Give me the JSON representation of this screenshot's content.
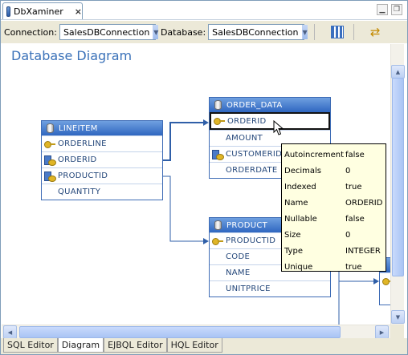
{
  "window": {
    "title": "DbXaminer",
    "close_glyph": "×",
    "minimize_glyph": "▁",
    "restore_glyph": "❐"
  },
  "toolbar": {
    "connection_label": "Connection:",
    "connection_value": "SalesDBConnection",
    "database_label": "Database:",
    "database_value": "SalesDBConnection",
    "layout_icon": "grid-layout-icon",
    "swap_icon": "swap-arrows-icon"
  },
  "diagram": {
    "title": "Database Diagram",
    "entities": [
      {
        "name": "LINEITEM",
        "fields": [
          {
            "label": "ORDERLINE",
            "icon": "primary-key-icon"
          },
          {
            "label": "ORDERID",
            "icon": "foreign-key-icon"
          },
          {
            "label": "PRODUCTID",
            "icon": "foreign-key-icon"
          },
          {
            "label": "QUANTITY",
            "icon": ""
          }
        ]
      },
      {
        "name": "ORDER_DATA",
        "fields": [
          {
            "label": "ORDERID",
            "icon": "primary-key-icon",
            "selected": true
          },
          {
            "label": "AMOUNT",
            "icon": ""
          },
          {
            "label": "CUSTOMERID",
            "icon": "foreign-key-icon"
          },
          {
            "label": "ORDERDATE",
            "icon": ""
          }
        ]
      },
      {
        "name": "PRODUCT",
        "fields": [
          {
            "label": "PRODUCTID",
            "icon": "primary-key-icon"
          },
          {
            "label": "CODE",
            "icon": ""
          },
          {
            "label": "NAME",
            "icon": ""
          },
          {
            "label": "UNITPRICE",
            "icon": ""
          }
        ]
      }
    ]
  },
  "tooltip": {
    "rows": [
      {
        "key": "Autoincrement",
        "value": "false"
      },
      {
        "key": "Decimals",
        "value": "0"
      },
      {
        "key": "Indexed",
        "value": "true"
      },
      {
        "key": "Name",
        "value": "ORDERID"
      },
      {
        "key": "Nullable",
        "value": "false"
      },
      {
        "key": "Size",
        "value": "0"
      },
      {
        "key": "Type",
        "value": "INTEGER"
      },
      {
        "key": "Unique",
        "value": "true"
      }
    ]
  },
  "bottom_tabs": [
    {
      "label": "SQL Editor",
      "active": false
    },
    {
      "label": "Diagram",
      "active": true
    },
    {
      "label": "EJBQL Editor",
      "active": false
    },
    {
      "label": "HQL Editor",
      "active": false
    }
  ],
  "colors": {
    "accent": "#3b72b9",
    "entity_header": "#2f66c0",
    "tooltip_bg": "#ffffe1"
  }
}
